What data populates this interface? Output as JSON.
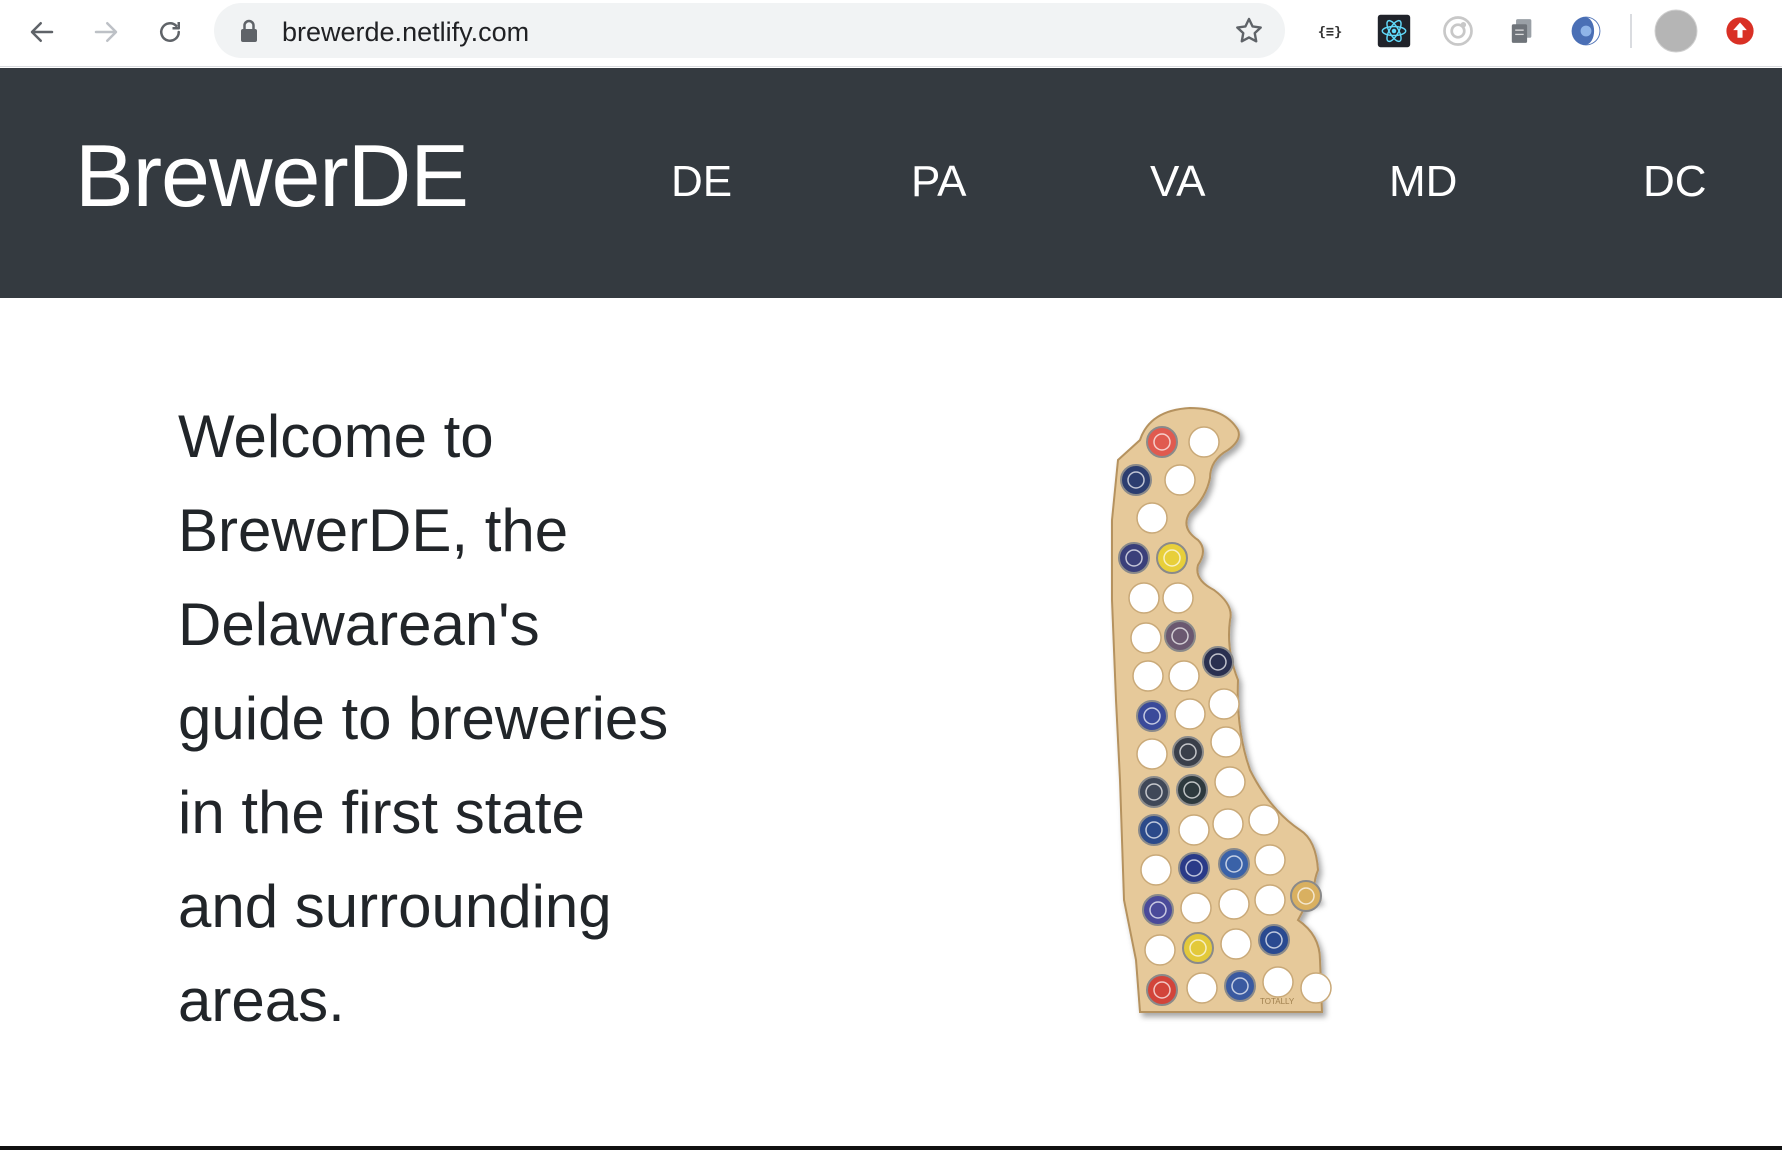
{
  "browser": {
    "url": "brewerde.netlify.com",
    "extensions": [
      "json-formatter-icon",
      "react-devtools-icon",
      "record-icon",
      "copy-icon",
      "vpn-icon",
      "profile-avatar",
      "upload-icon"
    ]
  },
  "navbar": {
    "brand": "BrewerDE",
    "links": [
      "DE",
      "PA",
      "VA",
      "MD",
      "DC"
    ]
  },
  "hero": {
    "lines": [
      "Welcome to",
      "BrewerDE, the",
      "Delawarean's",
      "guide to breweries",
      "in the first state",
      "and surrounding",
      "areas."
    ],
    "image_alt": "Delaware beer cap map"
  },
  "colors": {
    "navbar_bg": "#343a40",
    "wood": "#e3c79a",
    "page_bg": "#ffffff"
  }
}
